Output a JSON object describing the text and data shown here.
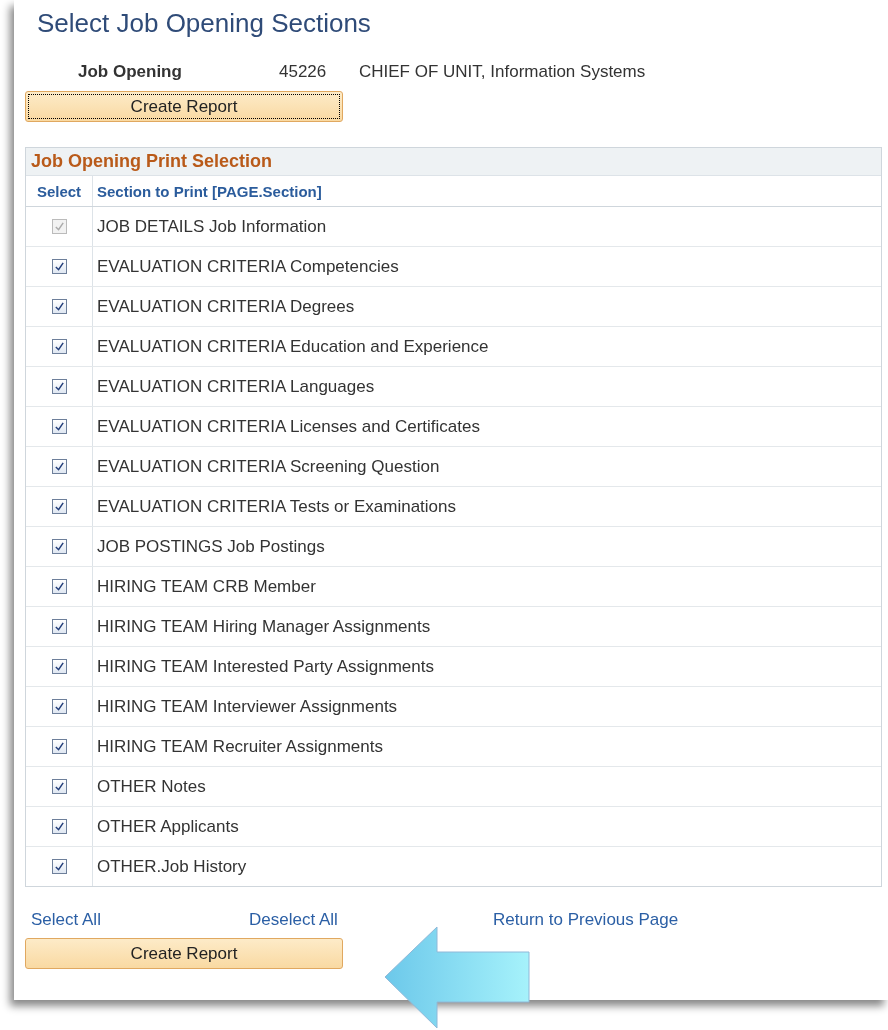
{
  "title": "Select Job Opening Sections",
  "job_opening": {
    "label": "Job Opening",
    "number": "45226",
    "description": "CHIEF OF UNIT, Information Systems"
  },
  "top_button": {
    "label": "Create Report",
    "focused": true
  },
  "grid": {
    "title": "Job Opening Print Selection",
    "columns": [
      "Select",
      "Section to Print [PAGE.Section]"
    ],
    "rows": [
      {
        "section": "JOB DETAILS Job Information",
        "checked": true,
        "disabled": true
      },
      {
        "section": "EVALUATION CRITERIA Competencies",
        "checked": true,
        "disabled": false
      },
      {
        "section": "EVALUATION CRITERIA Degrees",
        "checked": true,
        "disabled": false
      },
      {
        "section": "EVALUATION CRITERIA Education and Experience",
        "checked": true,
        "disabled": false
      },
      {
        "section": "EVALUATION CRITERIA Languages",
        "checked": true,
        "disabled": false
      },
      {
        "section": "EVALUATION CRITERIA Licenses and Certificates",
        "checked": true,
        "disabled": false
      },
      {
        "section": "EVALUATION CRITERIA Screening Question",
        "checked": true,
        "disabled": false
      },
      {
        "section": "EVALUATION CRITERIA Tests or Examinations",
        "checked": true,
        "disabled": false
      },
      {
        "section": "JOB POSTINGS Job Postings",
        "checked": true,
        "disabled": false
      },
      {
        "section": "HIRING TEAM CRB Member",
        "checked": true,
        "disabled": false
      },
      {
        "section": "HIRING TEAM Hiring Manager Assignments",
        "checked": true,
        "disabled": false
      },
      {
        "section": "HIRING TEAM Interested Party Assignments",
        "checked": true,
        "disabled": false
      },
      {
        "section": "HIRING TEAM Interviewer Assignments",
        "checked": true,
        "disabled": false
      },
      {
        "section": "HIRING TEAM Recruiter Assignments",
        "checked": true,
        "disabled": false
      },
      {
        "section": "OTHER Notes",
        "checked": true,
        "disabled": false
      },
      {
        "section": "OTHER Applicants",
        "checked": true,
        "disabled": false
      },
      {
        "section": "OTHER.Job History",
        "checked": true,
        "disabled": false
      }
    ]
  },
  "links": [
    "Select All",
    "Deselect All",
    "Return to Previous Page"
  ],
  "bottom_button": {
    "label": "Create Report",
    "focused": false
  }
}
